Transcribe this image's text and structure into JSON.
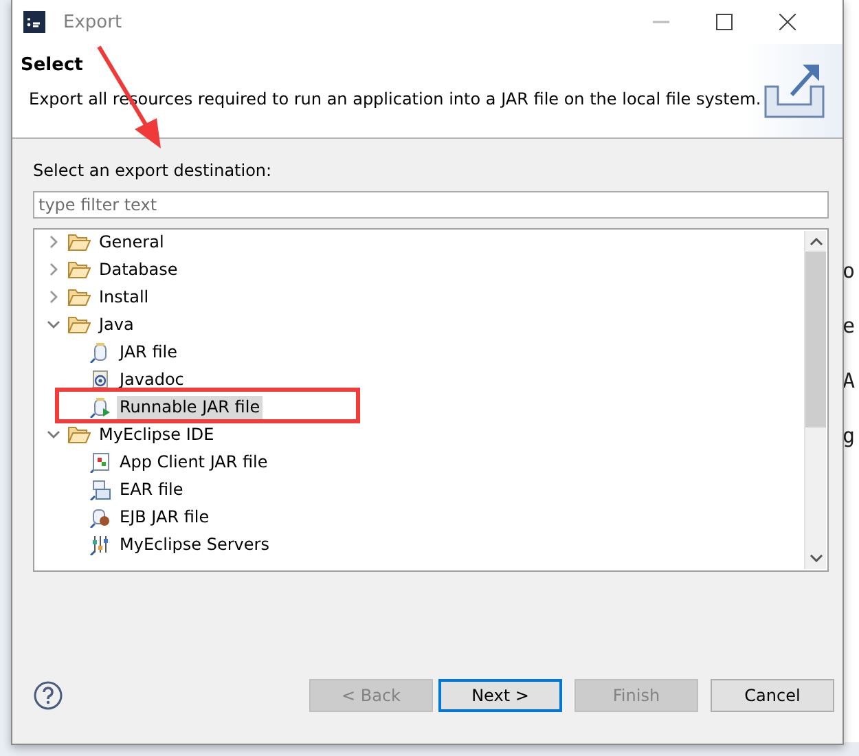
{
  "window": {
    "title": "Export"
  },
  "header": {
    "title": "Select",
    "description": "Export all resources required to run an application into a JAR file on the local file system."
  },
  "destination_label": "Select an export destination:",
  "filter": {
    "placeholder": "type filter text"
  },
  "tree": [
    {
      "label": "General",
      "expanded": false,
      "selected": false
    },
    {
      "label": "Database",
      "expanded": false,
      "selected": false
    },
    {
      "label": "Install",
      "expanded": false,
      "selected": false
    },
    {
      "label": "Java",
      "expanded": true,
      "selected": false,
      "children": [
        {
          "label": "JAR file",
          "kind": "jar",
          "selected": false
        },
        {
          "label": "Javadoc",
          "kind": "javadoc",
          "selected": false
        },
        {
          "label": "Runnable JAR file",
          "kind": "runnable",
          "selected": true
        }
      ]
    },
    {
      "label": "MyEclipse IDE",
      "expanded": true,
      "selected": false,
      "children": [
        {
          "label": "App Client JAR file",
          "kind": "appclient",
          "selected": false
        },
        {
          "label": "EAR file",
          "kind": "ear",
          "selected": false
        },
        {
          "label": "EJB JAR file",
          "kind": "ejb",
          "selected": false
        },
        {
          "label": "MyEclipse Servers",
          "kind": "servers",
          "selected": false
        }
      ]
    }
  ],
  "buttons": [
    {
      "label": "< Back",
      "disabled": true,
      "default": false
    },
    {
      "label": "Next >",
      "disabled": false,
      "default": true
    },
    {
      "label": "Finish",
      "disabled": true,
      "default": false
    },
    {
      "label": "Cancel",
      "disabled": false,
      "default": false
    }
  ],
  "background_fragments": [
    "o",
    "e",
    "A",
    "g"
  ]
}
